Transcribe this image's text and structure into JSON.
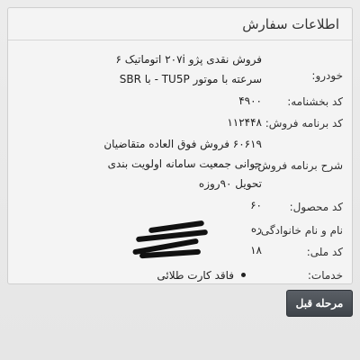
{
  "panel": {
    "title": "اطلاعات سفارش"
  },
  "fields": {
    "vehicle": {
      "label": "خودرو:",
      "lines": [
        "فروش نقدی پژو ۲۰۷i اتوماتیک ۶",
        "سرعته با موتور TU5P - با SBR"
      ]
    },
    "dealer_code": {
      "label": "کد بخشنامه:",
      "value": "۴۹۰۰"
    },
    "sale_program_code": {
      "label": "کد برنامه فروش:",
      "value": "۱۱۲۴۴۸"
    },
    "sale_program_desc": {
      "label": "شرح برنامه فروش:",
      "lines": [
        "۶۰۶۱۹ فروش فوق العاده متقاضیان",
        "جوانی جمعیت سامانه اولویت بندی",
        "تحویل ۹۰روزه"
      ]
    },
    "product_code": {
      "label": "کد محصول:",
      "value": "۶۰"
    },
    "full_name": {
      "label": "نام و نام خانوادگی:",
      "value": "ره"
    },
    "national_id": {
      "label": "کد ملی:",
      "value": "۱۸"
    },
    "services": {
      "label": "خدمات:",
      "items": [
        "فاقد کارت طلائی"
      ]
    }
  },
  "actions": {
    "prev_label": "مرحله قبل"
  }
}
